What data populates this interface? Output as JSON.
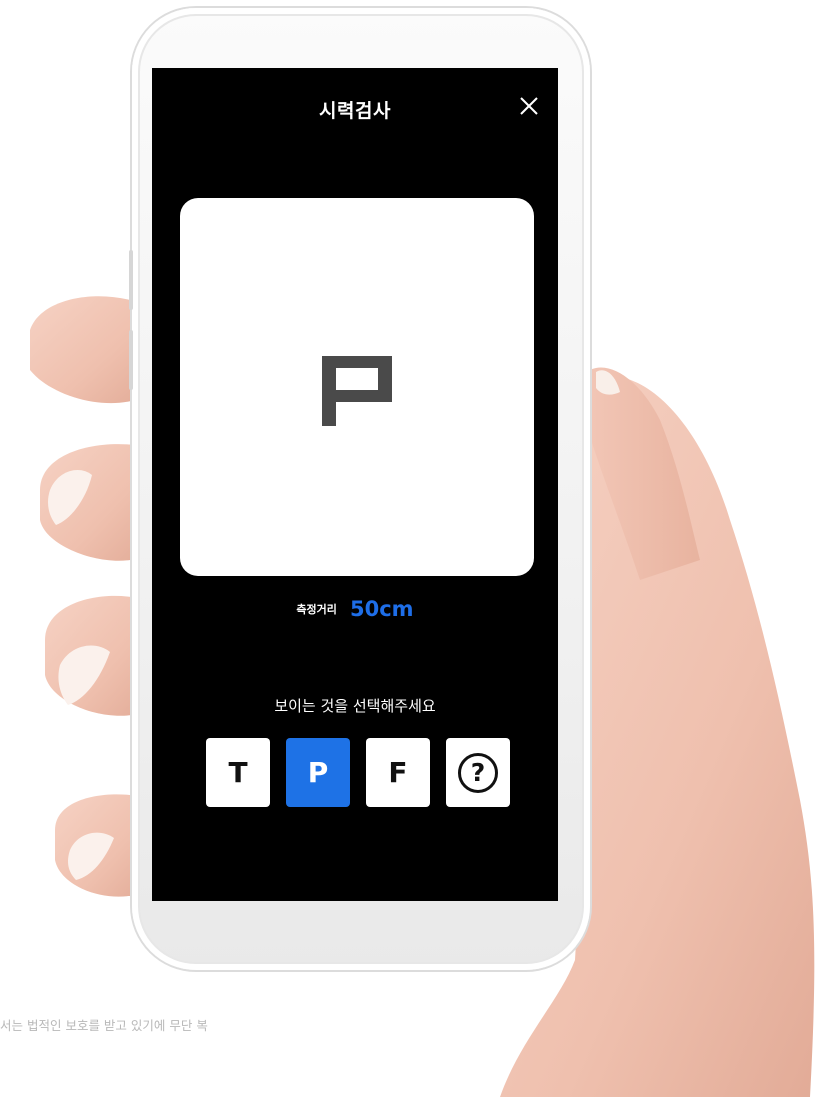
{
  "screen": {
    "title": "시력검사",
    "close_icon": "close-icon",
    "optotype": {
      "letter": "P",
      "color": "#4a4a4a",
      "background": "#ffffff"
    },
    "distance": {
      "label": "측정거리",
      "value": "50cm",
      "value_color": "#1e6ee8"
    },
    "instruction": "보이는 것을 선택해주세요",
    "choices": [
      {
        "label": "T",
        "selected": false
      },
      {
        "label": "P",
        "selected": true
      },
      {
        "label": "F",
        "selected": false
      },
      {
        "label": "?",
        "icon": "question-circle-icon",
        "selected": false
      }
    ],
    "selected_color": "#1e72e6"
  },
  "footer_note": "서는 법적인 보호를 받고 있기에 무단 복"
}
